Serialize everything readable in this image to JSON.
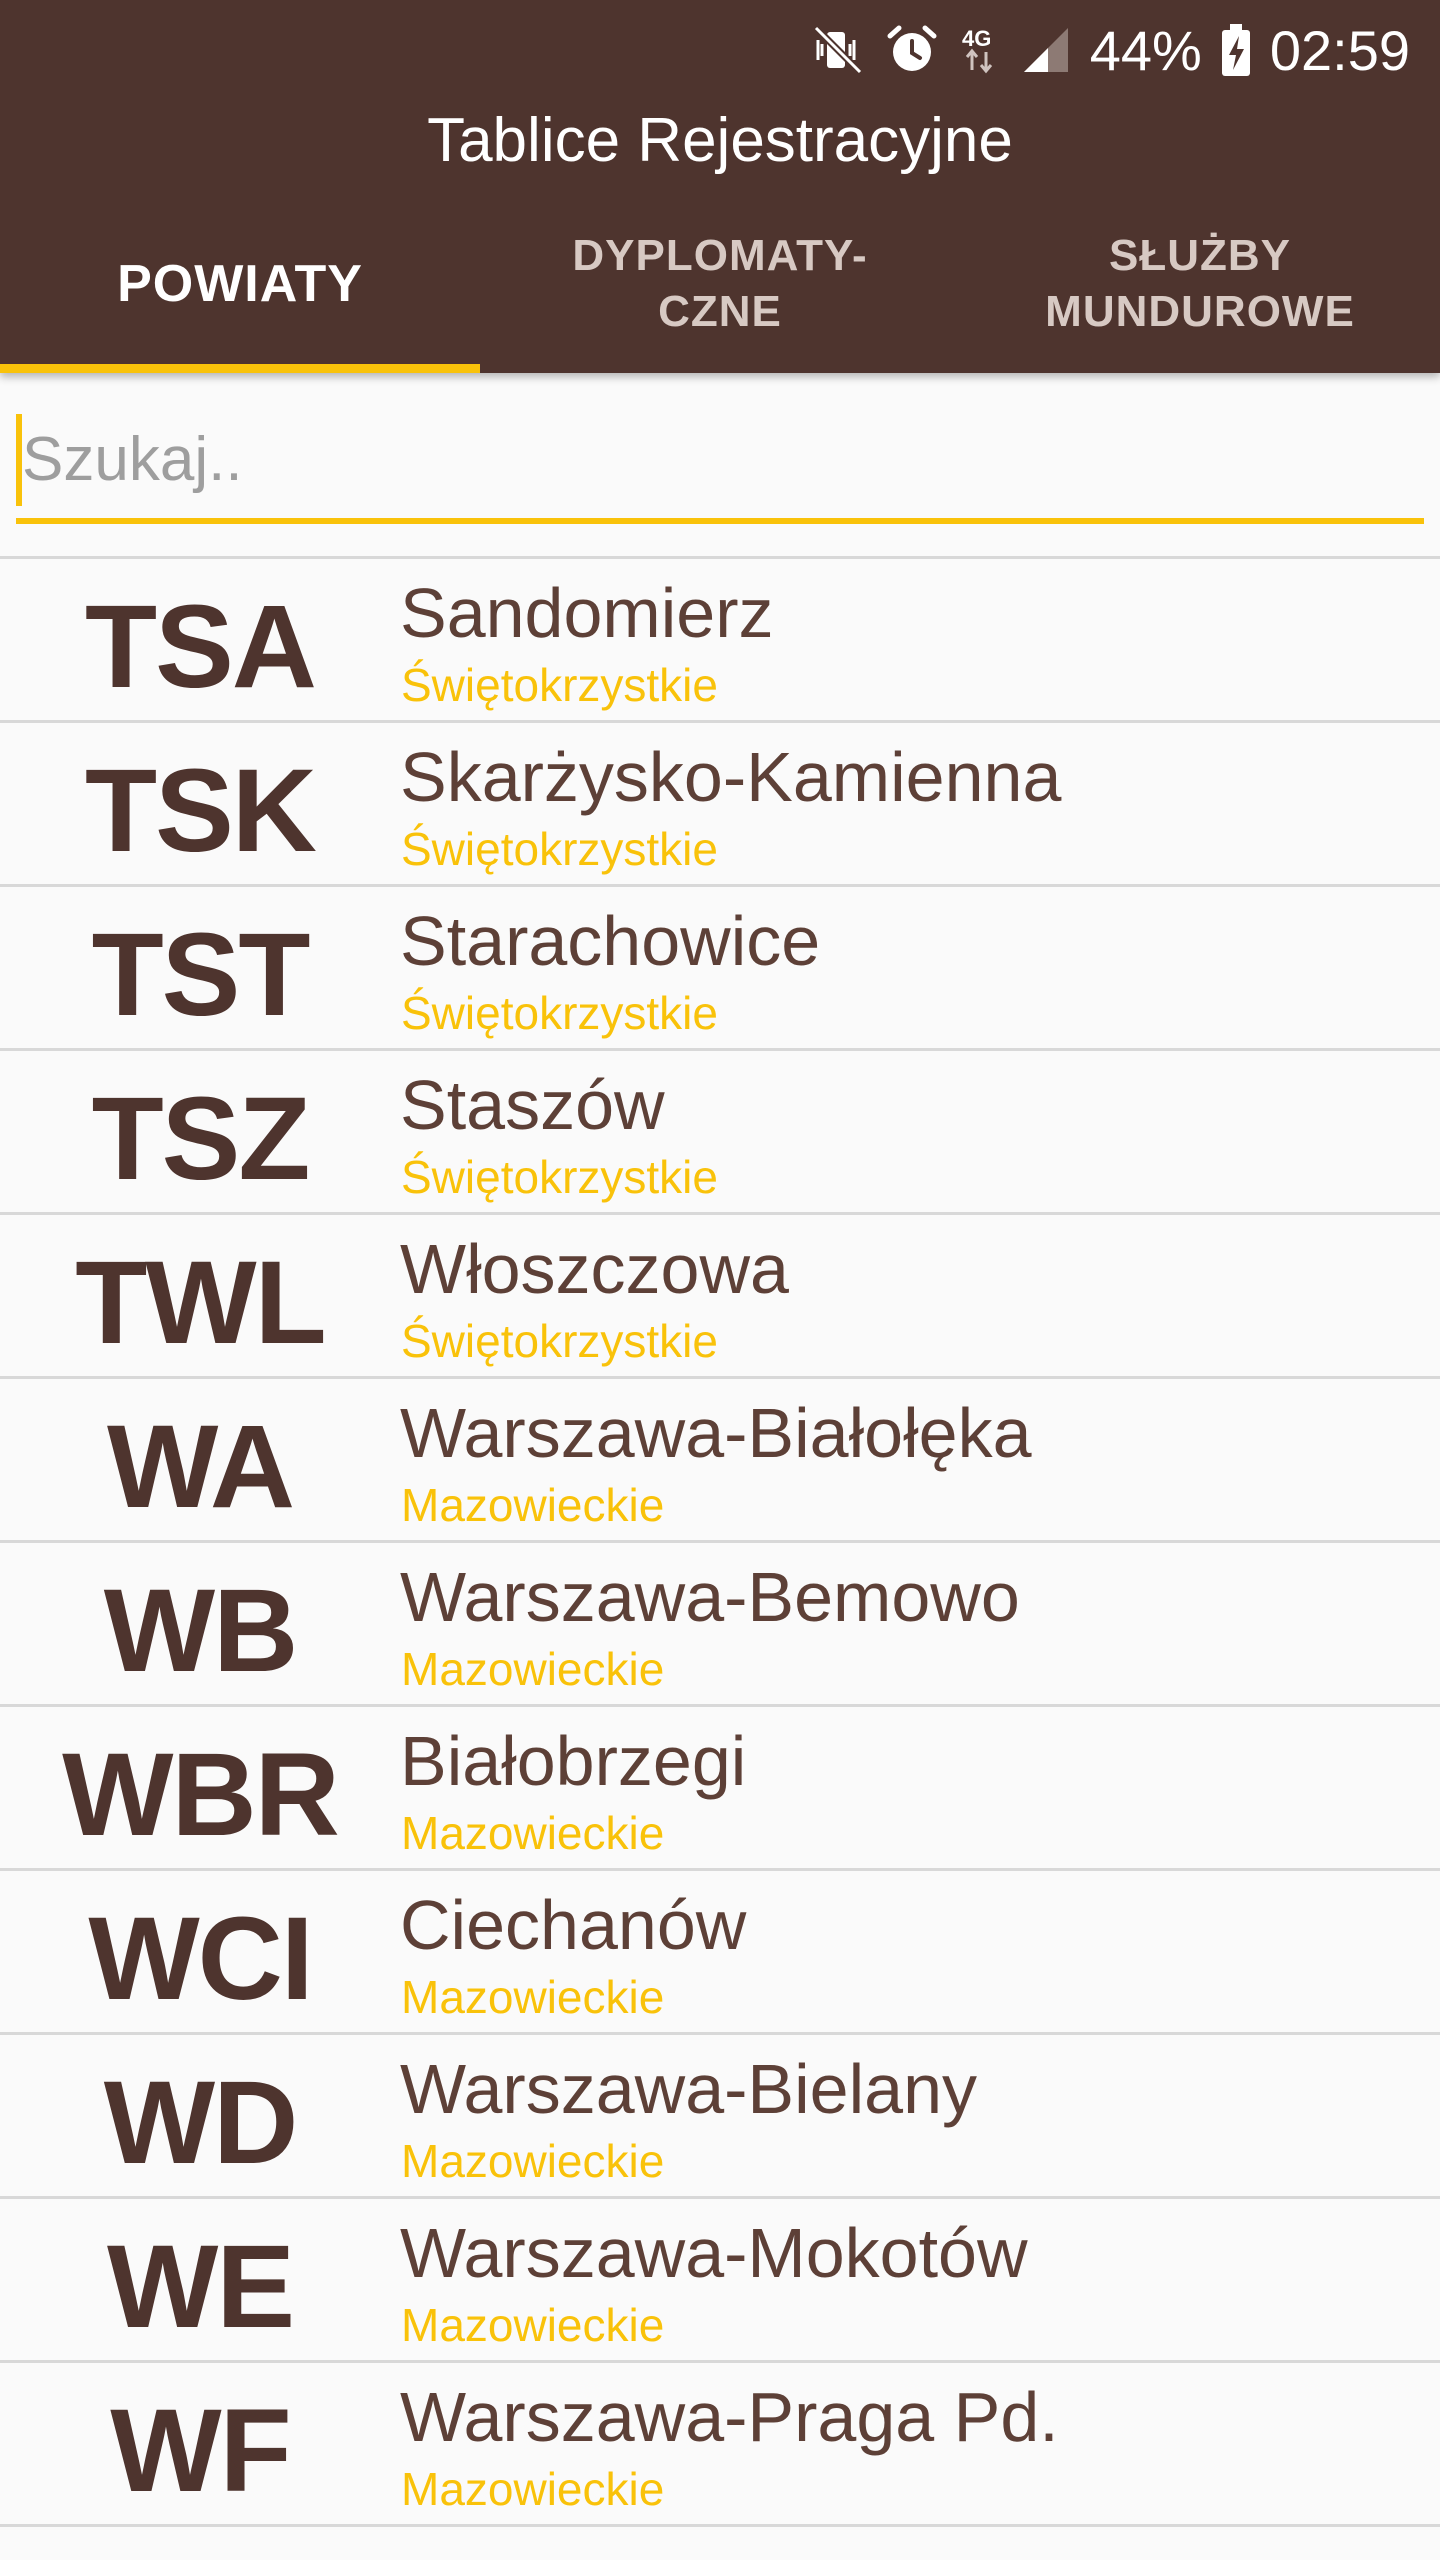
{
  "colors": {
    "primary": "#4e342e",
    "accent": "#f9c20a",
    "text": "#5d4037",
    "background": "#fafafa"
  },
  "status_bar": {
    "icons": [
      "mute-vibrate-icon",
      "alarm-icon",
      "network-4g-icon",
      "signal-icon",
      "battery-charging-icon"
    ],
    "network_label": "4G",
    "battery": "44%",
    "time": "02:59"
  },
  "app": {
    "title": "Tablice Rejestracyjne"
  },
  "tabs": [
    {
      "label": "POWIATY",
      "active": true
    },
    {
      "label": "DYPLOMATY-\nCZNE",
      "active": false
    },
    {
      "label": "SŁUŻBY\nMUNDUROWE",
      "active": false
    }
  ],
  "search": {
    "placeholder": "Szukaj..",
    "value": ""
  },
  "list": [
    {
      "code": "TSA",
      "city": "Sandomierz",
      "region": "Świętokrzystkie"
    },
    {
      "code": "TSK",
      "city": "Skarżysko-Kamienna",
      "region": "Świętokrzystkie"
    },
    {
      "code": "TST",
      "city": "Starachowice",
      "region": "Świętokrzystkie"
    },
    {
      "code": "TSZ",
      "city": "Staszów",
      "region": "Świętokrzystkie"
    },
    {
      "code": "TWL",
      "city": "Włoszczowa",
      "region": "Świętokrzystkie"
    },
    {
      "code": "WA",
      "city": "Warszawa-Białołęka",
      "region": "Mazowieckie"
    },
    {
      "code": "WB",
      "city": "Warszawa-Bemowo",
      "region": "Mazowieckie"
    },
    {
      "code": "WBR",
      "city": "Białobrzegi",
      "region": "Mazowieckie"
    },
    {
      "code": "WCI",
      "city": "Ciechanów",
      "region": "Mazowieckie"
    },
    {
      "code": "WD",
      "city": "Warszawa-Bielany",
      "region": "Mazowieckie"
    },
    {
      "code": "WE",
      "city": "Warszawa-Mokotów",
      "region": "Mazowieckie"
    },
    {
      "code": "WF",
      "city": "Warszawa-Praga Pd.",
      "region": "Mazowieckie"
    }
  ]
}
